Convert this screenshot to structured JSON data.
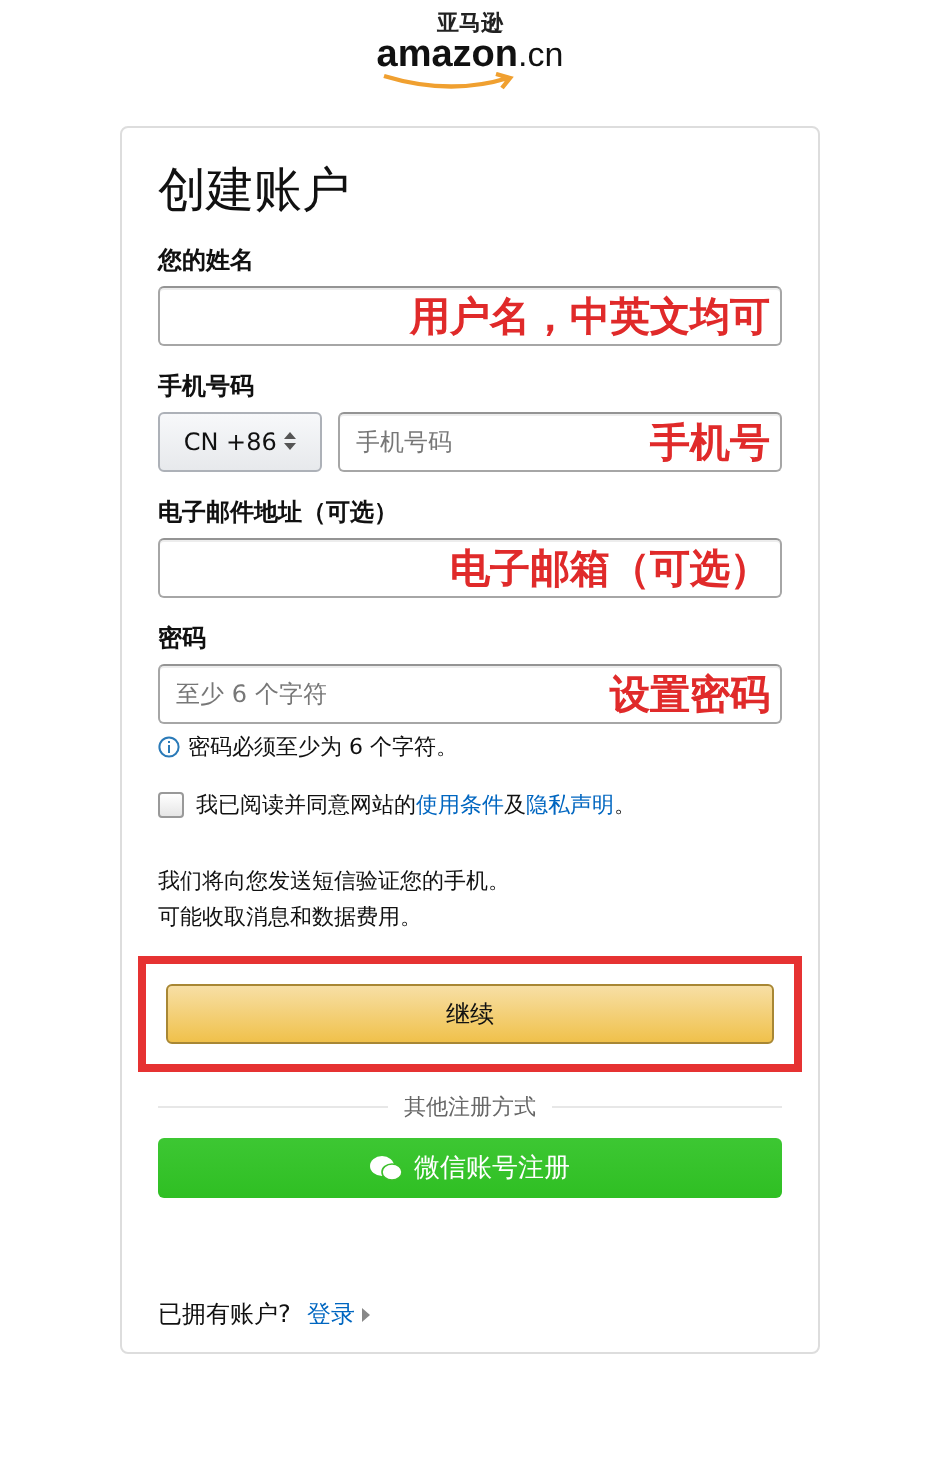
{
  "logo": {
    "chinese": "亚马逊",
    "wordmark": "amazon",
    "suffix": ".cn"
  },
  "form": {
    "title": "创建账户",
    "fields": [
      {
        "kind": "text",
        "label": "您的姓名",
        "annotation": "用户名，中英文均可"
      },
      {
        "kind": "phone",
        "label": "手机号码",
        "country": "CN +86",
        "placeholder": "手机号码",
        "annotation": "手机号"
      },
      {
        "kind": "text",
        "label": "电子邮件地址（可选）",
        "annotation": "电子邮箱（可选）"
      },
      {
        "kind": "password",
        "label": "密码",
        "placeholder": "至少 6 个字符",
        "annotation": "设置密码",
        "hint": "密码必须至少为 6 个字符。"
      }
    ],
    "agree": {
      "checked": false,
      "before": "我已阅读并同意网站的",
      "link1": "使用条件",
      "middle": "及",
      "link2": "隐私声明",
      "after": "。"
    },
    "notice": [
      "我们将向您发送短信验证您的手机。",
      "可能收取消息和数据费用。"
    ],
    "continue_button": {
      "label": "继续",
      "highlighted": true
    },
    "divider": "其他注册方式",
    "wechat_button": "微信账号注册",
    "signin": {
      "text": "已拥有账户?",
      "link": "登录"
    }
  }
}
